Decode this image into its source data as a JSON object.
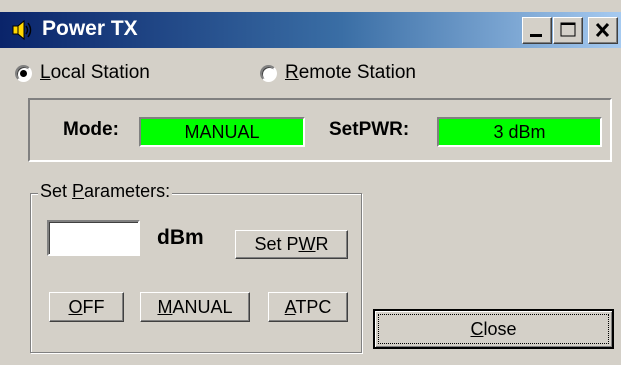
{
  "window": {
    "title": "Power TX"
  },
  "stations": {
    "local": {
      "pre": "",
      "accel": "L",
      "post": "ocal Station",
      "selected": true
    },
    "remote": {
      "pre": "",
      "accel": "R",
      "post": "emote Station",
      "selected": false
    }
  },
  "status": {
    "mode_label": "Mode:",
    "mode_value": "MANUAL",
    "setpwr_label": "SetPWR:",
    "setpwr_value": "3 dBm",
    "field_color": "#00ff00"
  },
  "parameters": {
    "group_pre": "Set ",
    "group_accel": "P",
    "group_post": "arameters:",
    "power_input_value": "",
    "unit_label": "dBm",
    "set_pwr": {
      "pre": "Set P",
      "accel": "W",
      "post": "R"
    }
  },
  "mode_buttons": {
    "off": {
      "pre": "",
      "accel": "O",
      "post": "FF"
    },
    "manual": {
      "pre": "",
      "accel": "M",
      "post": "ANUAL"
    },
    "atpc": {
      "pre": "",
      "accel": "A",
      "post": "TPC"
    }
  },
  "close_button": {
    "pre": "",
    "accel": "C",
    "post": "lose"
  },
  "icons": [
    "speaker-icon",
    "minimize-icon",
    "maximize-icon",
    "close-icon"
  ]
}
